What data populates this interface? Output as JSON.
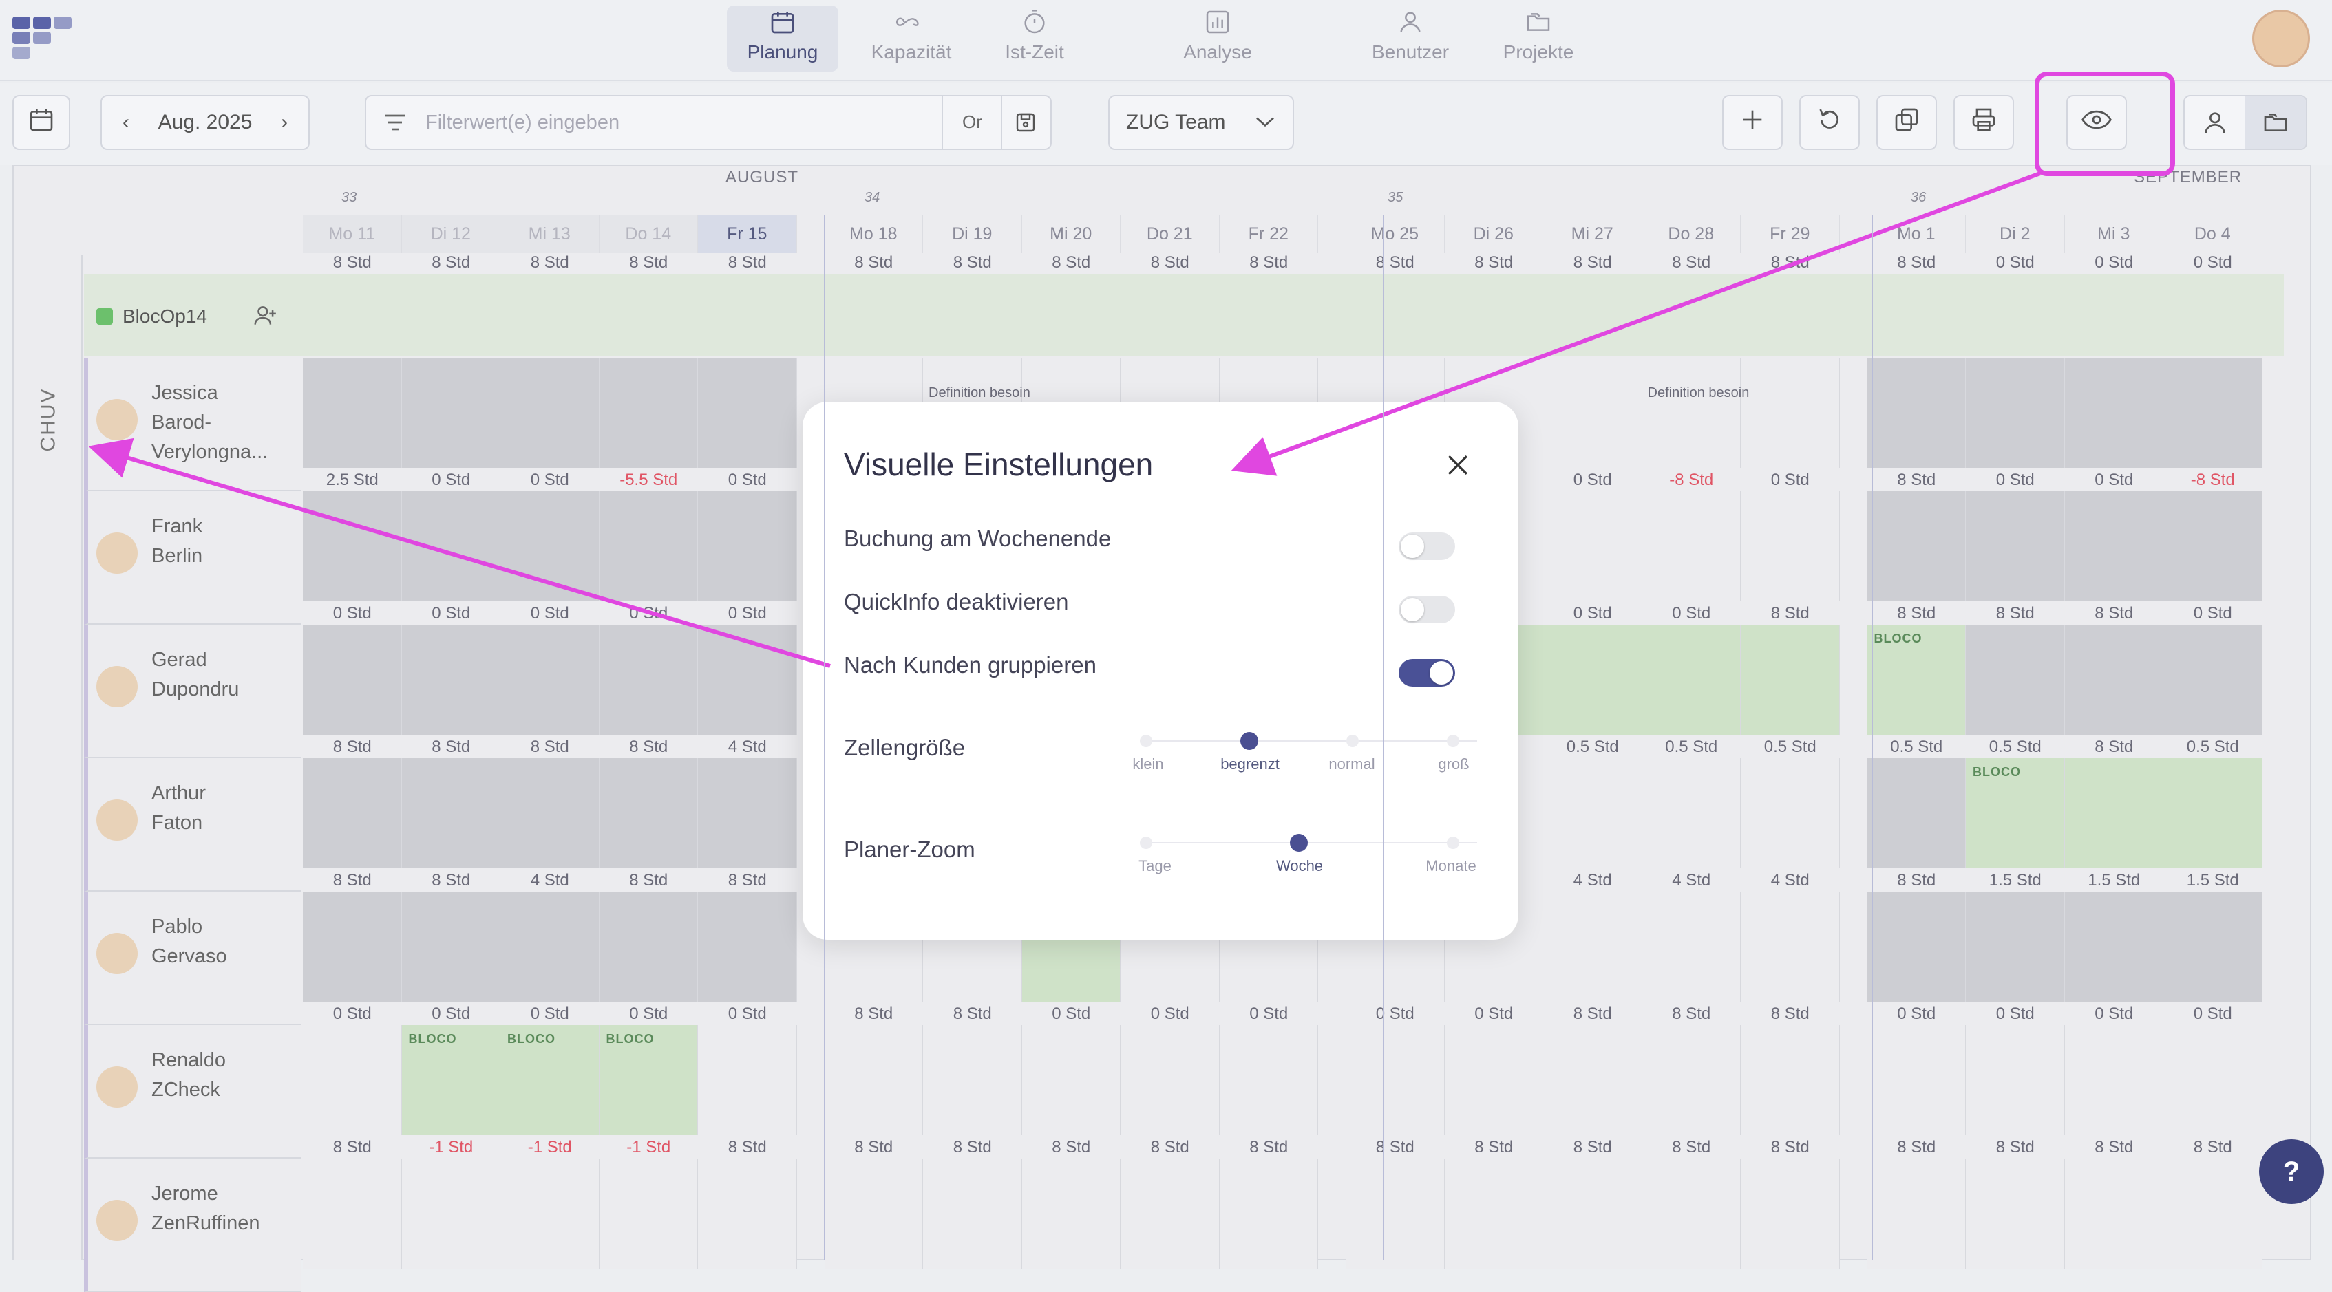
{
  "nav": {
    "items": [
      {
        "label": "Planung",
        "icon": "calendar-icon",
        "active": true
      },
      {
        "label": "Kapazität",
        "icon": "infinity-icon"
      },
      {
        "label": "Ist-Zeit",
        "icon": "stopwatch-icon"
      },
      {
        "label": "Analyse",
        "icon": "bar-chart-icon"
      },
      {
        "label": "Benutzer",
        "icon": "user-icon"
      },
      {
        "label": "Projekte",
        "icon": "folders-icon"
      }
    ]
  },
  "toolbar": {
    "month_label": "Aug. 2025",
    "filter_placeholder": "Filterwert(e) eingeben",
    "filter_or": "Or",
    "team_select": "ZUG Team"
  },
  "calendar": {
    "months": [
      "AUGUST",
      "SEPTEMBER"
    ],
    "weeks": [
      "33",
      "34",
      "35",
      "36"
    ],
    "days": [
      "Mo 11",
      "Di 12",
      "Mi 13",
      "Do 14",
      "Fr 15",
      "Mo 18",
      "Di 19",
      "Mi 20",
      "Do 21",
      "Fr 22",
      "Mo 25",
      "Di 26",
      "Mi 27",
      "Do 28",
      "Fr 29",
      "Mo 1",
      "Di 2",
      "Mi 3",
      "Do 4"
    ],
    "capacity_row": [
      "8 Std",
      "8 Std",
      "8 Std",
      "8 Std",
      "8 Std",
      "8 Std",
      "8 Std",
      "8 Std",
      "8 Std",
      "8 Std",
      "8 Std",
      "8 Std",
      "8 Std",
      "8 Std",
      "8 Std",
      "8 Std",
      "0 Std",
      "0 Std",
      "0 Std"
    ]
  },
  "group": {
    "side_label": "CHUV",
    "project_name": "BlocOp14",
    "project_color": "#6cc06c"
  },
  "people": [
    {
      "name_line1": "Jessica",
      "name_line2": "Barod-",
      "name_line3": "Verylongna...",
      "hours": [
        "2.5 Std",
        "0 Std",
        "0 Std",
        "-5.5 Std",
        "0 Std",
        "",
        "",
        "",
        "",
        "",
        "",
        "",
        "0 Std",
        "-8 Std",
        "0 Std",
        "8 Std",
        "0 Std",
        "0 Std",
        "-8 Std"
      ]
    },
    {
      "name_line1": "Frank",
      "name_line2": "Berlin",
      "hours": [
        "0 Std",
        "0 Std",
        "0 Std",
        "0 Std",
        "0 Std",
        "",
        "",
        "",
        "",
        "",
        "",
        "",
        "0 Std",
        "0 Std",
        "8 Std",
        "8 Std",
        "8 Std",
        "8 Std",
        "0 Std"
      ]
    },
    {
      "name_line1": "Gerad",
      "name_line2": "Dupondru",
      "hours": [
        "8 Std",
        "8 Std",
        "8 Std",
        "8 Std",
        "4 Std",
        "",
        "",
        "",
        "",
        "",
        "",
        "",
        "0.5 Std",
        "0.5 Std",
        "0.5 Std",
        "0.5 Std",
        "0.5 Std",
        "8 Std",
        "0.5 Std"
      ]
    },
    {
      "name_line1": "Arthur",
      "name_line2": "Faton",
      "hours": [
        "8 Std",
        "8 Std",
        "4 Std",
        "8 Std",
        "8 Std",
        "",
        "",
        "",
        "",
        "",
        "",
        "",
        "4 Std",
        "4 Std",
        "4 Std",
        "8 Std",
        "1.5 Std",
        "1.5 Std",
        "1.5 Std"
      ]
    },
    {
      "name_line1": "Pablo",
      "name_line2": "Gervaso",
      "hours": [
        "0 Std",
        "0 Std",
        "0 Std",
        "0 Std",
        "0 Std",
        "8 Std",
        "8 Std",
        "0 Std",
        "0 Std",
        "0 Std",
        "0 Std",
        "0 Std",
        "8 Std",
        "8 Std",
        "8 Std",
        "0 Std",
        "0 Std",
        "0 Std",
        "0 Std"
      ]
    },
    {
      "name_line1": "Renaldo",
      "name_line2": "ZCheck",
      "hours": [
        "8 Std",
        "-1 Std",
        "-1 Std",
        "-1 Std",
        "8 Std",
        "8 Std",
        "8 Std",
        "8 Std",
        "8 Std",
        "8 Std",
        "8 Std",
        "8 Std",
        "8 Std",
        "8 Std",
        "8 Std",
        "8 Std",
        "8 Std",
        "8 Std",
        "8 Std"
      ]
    },
    {
      "name_line1": "Jerome",
      "name_line2": "ZenRuffinen",
      "hours": []
    }
  ],
  "cell_texts": {
    "bloco": "BLOCO",
    "definition": "Definition besoin"
  },
  "modal": {
    "title": "Visuelle Einstellungen",
    "toggles": [
      {
        "label": "Buchung am Wochenende",
        "on": false
      },
      {
        "label": "QuickInfo deaktivieren",
        "on": false
      },
      {
        "label": "Nach Kunden gruppieren",
        "on": true
      }
    ],
    "cell_size": {
      "label": "Zellengröße",
      "options": [
        "klein",
        "begrenzt",
        "normal",
        "groß"
      ],
      "selected": "begrenzt"
    },
    "zoom": {
      "label": "Planer-Zoom",
      "options": [
        "Tage",
        "Woche",
        "Monate"
      ],
      "selected": "Woche"
    }
  },
  "help_label": "?",
  "colors": {
    "accent": "#4a5196",
    "annotation": "#e047e0",
    "negative": "#e05565",
    "booking_green": "#cfe2c8"
  }
}
